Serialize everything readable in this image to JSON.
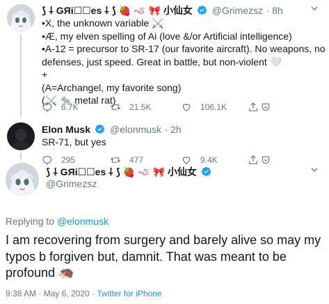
{
  "tweet1": {
    "name": "⟆ ⸸ GЯi☐☐es ⸸ ⟆ 🍓 🪱 🎀 小仙女",
    "handle": "@Grimezsz",
    "time": "· 8h",
    "lines": [
      "•X, the unknown variable ⚔️",
      "•Æ, my elven spelling of Ai (love &/or Artificial intelligence)",
      "•A-12 = precursor to SR-17 (our favorite aircraft).  No weapons, no",
      "defenses, just speed.  Great in battle, but non-violent 🤍",
      "+",
      "(A=Archangel, my favorite song)",
      "(⚔️ 🐀 metal rat)"
    ],
    "replies": "6.7K",
    "retweets": "21.5K",
    "likes": "106.1K"
  },
  "tweet2": {
    "name": "Elon Musk",
    "handle": "@elonmusk",
    "time": "· 2h",
    "text": "SR-71, but yes",
    "replies": "295",
    "retweets": "477",
    "likes": "9.4K"
  },
  "tweet3": {
    "name": "⟆ ⸸ GЯi☐☐es ⸸ ⟆ 🍓 🪱 🎀 小仙女",
    "handle": "@Grimezsz",
    "replying_prefix": "Replying to",
    "replying_handle": "@elonmusk",
    "text": "I am recovering from surgery and barely alive so may my typos b forgiven but, damnit.  That was meant to be profound 🦔",
    "timestamp": "9:38 AM · May 6, 2020 ·",
    "source": "Twitter for iPhone"
  },
  "colors": {
    "accent": "#1b95e0",
    "muted": "#657786",
    "text": "#14171a"
  }
}
